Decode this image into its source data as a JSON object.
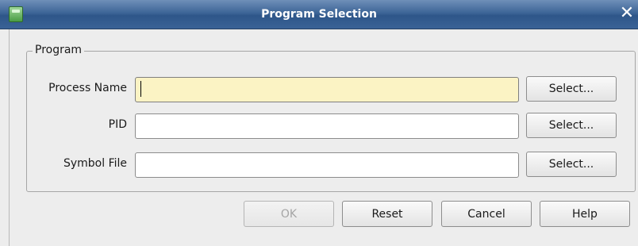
{
  "window": {
    "title": "Program Selection",
    "close_glyph": "✕",
    "app_icon": "app-icon"
  },
  "group": {
    "legend": "Program"
  },
  "fields": [
    {
      "label": "Process Name",
      "value": "",
      "button_label": "Select...",
      "focused": true
    },
    {
      "label": "PID",
      "value": "",
      "button_label": "Select..."
    },
    {
      "label": "Symbol File",
      "value": "",
      "button_label": "Select..."
    }
  ],
  "actions": {
    "ok_label": "OK",
    "reset_label": "Reset",
    "cancel_label": "Cancel",
    "help_label": "Help"
  },
  "colors": {
    "titlebar": "#3d6597",
    "focused_field": "#fbf3c4"
  }
}
